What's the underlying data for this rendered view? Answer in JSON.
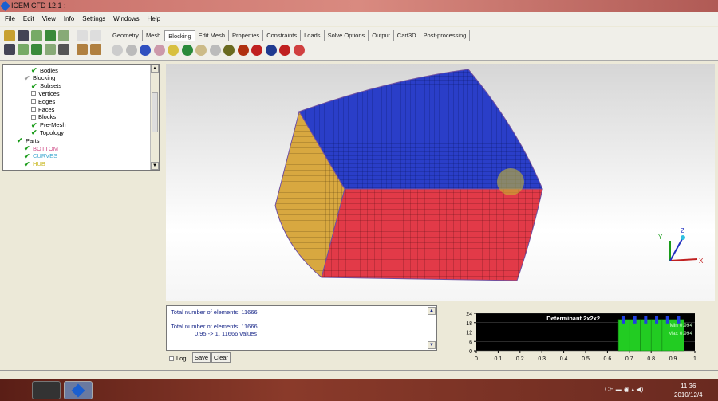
{
  "window": {
    "title": "ICEM CFD 12.1 :"
  },
  "menu": [
    "File",
    "Edit",
    "View",
    "Info",
    "Settings",
    "Windows",
    "Help"
  ],
  "tabs": [
    "Geometry",
    "Mesh",
    "Blocking",
    "Edit Mesh",
    "Properties",
    "Constraints",
    "Loads",
    "Solve Options",
    "Output",
    "Cart3D",
    "Post-processing"
  ],
  "active_tab": "Blocking",
  "tree": [
    {
      "label": "Bodies",
      "state": "checked",
      "color": "#000000"
    },
    {
      "label": "Blocking",
      "state": "partial",
      "color": "#000000"
    },
    {
      "label": "Subsets",
      "state": "checked",
      "color": "#000000"
    },
    {
      "label": "Vertices",
      "state": "unchecked",
      "color": "#000000"
    },
    {
      "label": "Edges",
      "state": "unchecked",
      "color": "#000000"
    },
    {
      "label": "Faces",
      "state": "unchecked",
      "color": "#000000"
    },
    {
      "label": "Blocks",
      "state": "unchecked",
      "color": "#000000"
    },
    {
      "label": "Pre-Mesh",
      "state": "checked",
      "color": "#000000"
    },
    {
      "label": "Topology",
      "state": "checked",
      "color": "#000000"
    },
    {
      "label": "Parts",
      "state": "checked",
      "color": "#000000"
    },
    {
      "label": "BOTTOM",
      "state": "checked",
      "color": "#d0508a"
    },
    {
      "label": "CURVES",
      "state": "checked",
      "color": "#40a8d0"
    },
    {
      "label": "HUB",
      "state": "checked",
      "color": "#c8b820"
    }
  ],
  "messages": {
    "line1": "Total number of elements: 11666",
    "line2": "Total number of elements: 11666",
    "line3": "0.95 -> 1, 11666 values"
  },
  "controls": {
    "log_label": "Log",
    "save_label": "Save",
    "clear_label": "Clear"
  },
  "axes_labels": {
    "y": "Y",
    "z": "Z",
    "x": "X"
  },
  "chart_data": {
    "type": "bar",
    "title": "Determinant 2x2x2",
    "bins": [
      0.65,
      0.7,
      0.75,
      0.8,
      0.85,
      0.9,
      0.95
    ],
    "values": [
      20,
      20,
      20,
      20,
      20,
      20
    ],
    "xlim": [
      0,
      1
    ],
    "ylim": [
      0,
      24
    ],
    "xticks": [
      "0",
      "0.1",
      "0.2",
      "0.3",
      "0.4",
      "0.5",
      "0.6",
      "0.7",
      "0.8",
      "0.9",
      "1"
    ],
    "yticks": [
      "0",
      "6",
      "12",
      "18",
      "24"
    ],
    "min_label": "Min 0.994",
    "max_label": "Max 0.994"
  },
  "clock": {
    "time": "11:36",
    "date": "2010/12/4"
  }
}
